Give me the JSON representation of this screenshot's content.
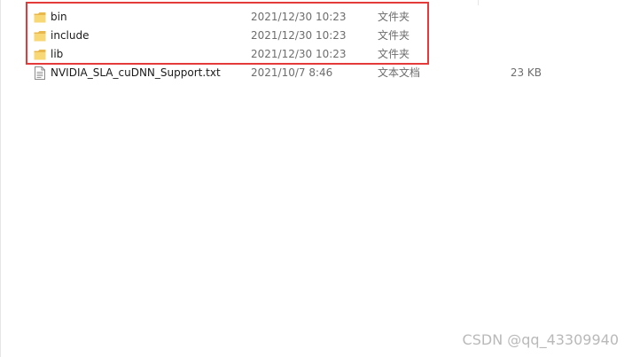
{
  "files": [
    {
      "name": "bin",
      "date": "2021/12/30 10:23",
      "type": "文件夹",
      "size": "",
      "icon": "folder-icon"
    },
    {
      "name": "include",
      "date": "2021/12/30 10:23",
      "type": "文件夹",
      "size": "",
      "icon": "folder-icon"
    },
    {
      "name": "lib",
      "date": "2021/12/30 10:23",
      "type": "文件夹",
      "size": "",
      "icon": "folder-icon"
    },
    {
      "name": "NVIDIA_SLA_cuDNN_Support.txt",
      "date": "2021/10/7 8:46",
      "type": "文本文档",
      "size": "23 KB",
      "icon": "text-document-icon"
    }
  ],
  "watermark": "CSDN @qq_43309940",
  "colors": {
    "highlight_border": "#e53a3a",
    "folder": "#f8d775",
    "folder_dark": "#e8b94a",
    "secondary_text": "#6d6d6d"
  }
}
